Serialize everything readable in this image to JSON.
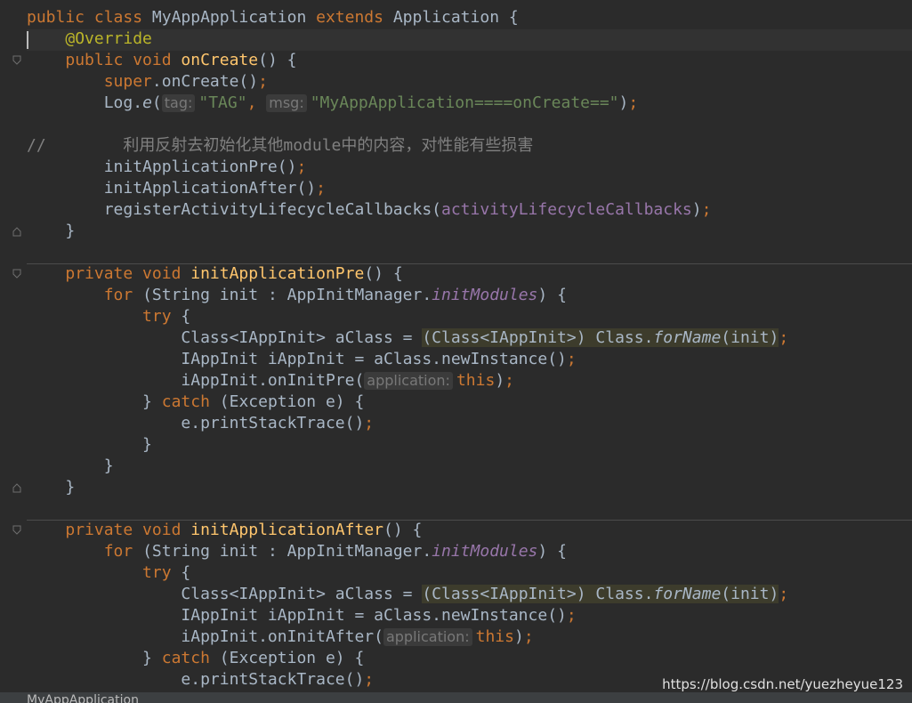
{
  "editor": {
    "lines": {
      "l1": {
        "kw1": "public class ",
        "cls": "MyAppApplication ",
        "kw2": "extends ",
        "rest": "Application {"
      },
      "l2": {
        "ann": "@Override"
      },
      "l3": {
        "kw": "public void ",
        "fn": "onCreate",
        "rest": "() {"
      },
      "l4": {
        "kw": "super",
        ".": ".onCreate()",
        "semi": ";"
      },
      "l5": {
        "a": "Log.",
        "b": "e",
        "c": "(",
        "hint1": "tag:",
        "s1": "\"TAG\"",
        "comma": ", ",
        "hint2": "msg:",
        "s2": "\"MyAppApplication====onCreate==\"",
        "d": ")",
        "semi": ";"
      },
      "l6": {},
      "l7": {
        "cm": "//        ",
        "cjk1": "利用反射去初始化其他",
        "mod": "module",
        "cjk2": "中的内容，对性能有些损害"
      },
      "l8": {
        "a": "initApplicationPre()",
        "semi": ";"
      },
      "l9": {
        "a": "initApplicationAfter()",
        "semi": ";"
      },
      "l10": {
        "a": "registerActivityLifecycleCallbacks(",
        "fld": "activityLifecycleCallbacks",
        "b": ")",
        "semi": ";"
      },
      "l11": {
        "a": "}"
      },
      "l12": {
        "kw": "private void ",
        "fn": "initApplicationPre",
        "rest": "() {"
      },
      "l13": {
        "kw": "for ",
        "a": "(String init : AppInitManager.",
        "fld": "initModules",
        "b": ") {"
      },
      "l14": {
        "kw": "try ",
        "a": "{"
      },
      "l15": {
        "a": "Class<IAppInit> aClass = ",
        "hl1": "(Class<IAppInit>) Class.",
        "hlit": "forName",
        "hl2": "(init)",
        "semi": ";"
      },
      "l16": {
        "a": "IAppInit iAppInit = aClass.newInstance()",
        "semi": ";"
      },
      "l17": {
        "a": "iAppInit.onInitPre(",
        "hint": "application:",
        "kw": "this",
        "b": ")",
        "semi": ";"
      },
      "l18": {
        "a": "} ",
        "kw": "catch ",
        "b": "(Exception e) {"
      },
      "l19": {
        "a": "e.printStackTrace()",
        "semi": ";"
      },
      "l20": {
        "a": "}"
      },
      "l21": {
        "a": "}"
      },
      "l22": {
        "a": "}"
      },
      "l23": {
        "kw": "private void ",
        "fn": "initApplicationAfter",
        "rest": "() {"
      },
      "l24": {
        "kw": "for ",
        "a": "(String init : AppInitManager.",
        "fld": "initModules",
        "b": ") {"
      },
      "l25": {
        "kw": "try ",
        "a": "{"
      },
      "l26": {
        "a": "Class<IAppInit> aClass = ",
        "hl1": "(Class<IAppInit>) Class.",
        "hlit": "forName",
        "hl2": "(init)",
        "semi": ";"
      },
      "l27": {
        "a": "IAppInit iAppInit = aClass.newInstance()",
        "semi": ";"
      },
      "l28": {
        "a": "iAppInit.onInitAfter(",
        "hint": "application:",
        "kw": "this",
        "b": ")",
        "semi": ";"
      },
      "l29": {
        "a": "} ",
        "kw": "catch ",
        "b": "(Exception e) {"
      },
      "l30": {
        "a": "e.printStackTrace()",
        "semi": ";"
      }
    }
  },
  "statusbar": {
    "breadcrumb": "MyAppApplication"
  },
  "watermark": "https://blog.csdn.net/yuezheyue123",
  "colors": {
    "background": "#2b2b2b",
    "keyword": "#cc7832",
    "annotation": "#bbb529",
    "method": "#ffc66d",
    "string": "#6a8759",
    "field": "#9876aa",
    "comment": "#808080",
    "text": "#a9b7c6"
  },
  "icons": [
    "fold-open-icon",
    "fold-close-icon"
  ]
}
